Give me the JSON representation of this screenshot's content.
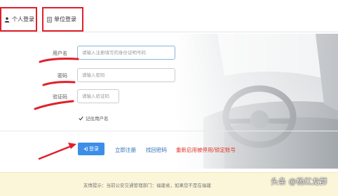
{
  "tabs": [
    {
      "label": "个人登录",
      "icon": "user-icon",
      "active": true
    },
    {
      "label": "单位登录",
      "icon": "document-icon",
      "active": false
    }
  ],
  "form": {
    "username_label": "用户名",
    "username_placeholder": "请输入注册填写的身份证明号码",
    "password_label": "密码",
    "password_placeholder": "请输入密码",
    "captcha_label": "验证码",
    "captcha_placeholder": "请输入验证码",
    "remember_label": "记住用户名",
    "remember_checked": true
  },
  "actions": {
    "login_label": "登录",
    "register_label": "立即注册",
    "recover_label": "找回密码",
    "reactivate_label": "重新启用被停用/锁定账号"
  },
  "notice": {
    "text": "友情提示：当前公安交通管理部门：福建省，如果您不是在福建"
  },
  "watermark": "头条 @杨红龙群",
  "colors": {
    "annotation_red": "#e0202a",
    "login_blue": "#3c8ee8",
    "link_blue": "#2a6fb4",
    "link_red": "#e2352f",
    "notice_bg": "#fbf6da"
  }
}
